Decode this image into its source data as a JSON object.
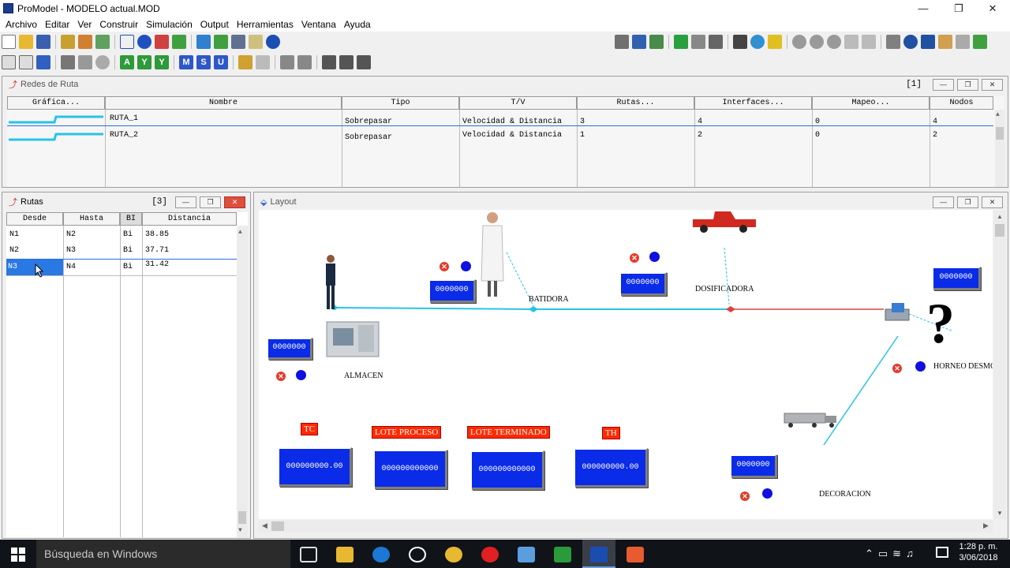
{
  "window": {
    "title": "ProModel - MODELO actual.MOD",
    "ctl_min": "—",
    "ctl_restore": "❐",
    "ctl_close": "✕"
  },
  "menu": [
    "Archivo",
    "Editar",
    "Ver",
    "Construir",
    "Simulación",
    "Output",
    "Herramientas",
    "Ventana",
    "Ayuda"
  ],
  "toolbar2_letters": [
    "A",
    "Y",
    "Y",
    "M",
    "S",
    "U"
  ],
  "redes": {
    "title": "Redes de Ruta",
    "count": "[1]",
    "headers": [
      "Gráfica...",
      "Nombre",
      "Tipo",
      "T/V",
      "Rutas...",
      "Interfaces...",
      "Mapeo...",
      "Nodos"
    ],
    "rows": [
      [
        "RUTA_1",
        "Sobrepasar",
        "Velocidad & Distancia",
        "3",
        "4",
        "0",
        "4"
      ],
      [
        "RUTA_2",
        "Sobrepasar",
        "Velocidad & Distancia",
        "1",
        "2",
        "0",
        "2"
      ]
    ]
  },
  "rutas": {
    "title": "Rutas",
    "count": "[3]",
    "headers": [
      "Desde",
      "Hasta",
      "BI",
      "Distancia"
    ],
    "rows": [
      [
        "N1",
        "N2",
        "Bi",
        "38.85"
      ],
      [
        "N2",
        "N3",
        "Bi",
        "37.71"
      ],
      [
        "N3",
        "N4",
        "Bi",
        "31.42"
      ]
    ]
  },
  "layout": {
    "title": "Layout",
    "labels": {
      "batidora": "BATIDORA",
      "dosificadora": "DOSIFICADORA",
      "almacen": "ALMACEN",
      "horneo": "HORNEO DESMO",
      "decoracion": "DECORACION"
    },
    "counters": {
      "c1": "0000000",
      "c2": "0000000",
      "c3": "0000000",
      "c4": "0000000",
      "c5": "0000000"
    },
    "red_labels": {
      "tc": "TC",
      "lote_proceso": "LOTE PROCESO",
      "lote_terminado": "LOTE TERMINADO",
      "th": "TH"
    },
    "big_counters": {
      "tc": "000000000.00",
      "lote_proceso": "000000000000",
      "lote_terminado": "000000000000",
      "th": "000000000.00"
    },
    "question": "?"
  },
  "taskbar": {
    "search": "Búsqueda en Windows",
    "time": "1:28 p. m.",
    "date": "3/06/2018"
  }
}
